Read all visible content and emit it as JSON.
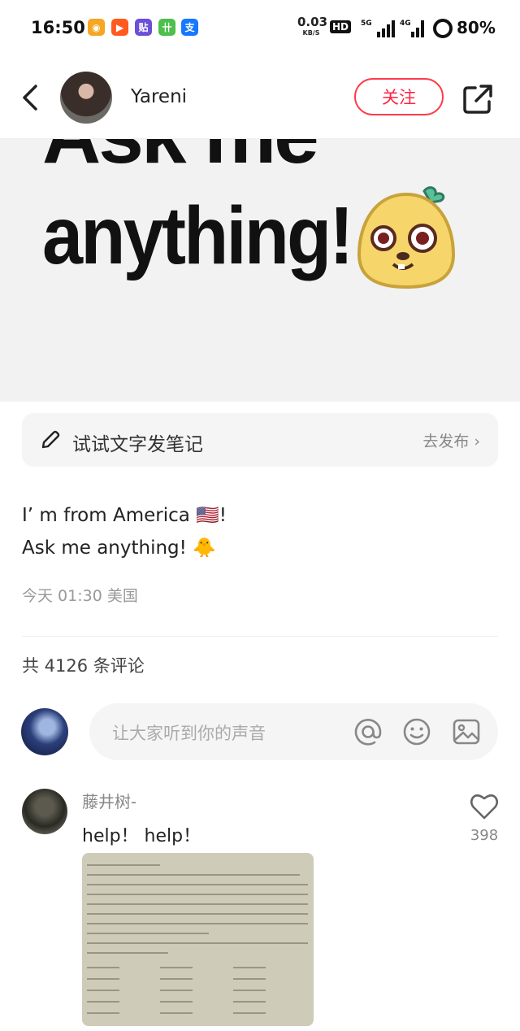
{
  "status_bar": {
    "time": "16:50",
    "net_speed_value": "0.03",
    "net_speed_unit": "KB/S",
    "hd": "HD",
    "battery": "80%",
    "app_icons": [
      "weibo-icon",
      "video-app-icon",
      "tieba-icon",
      "shopping-icon",
      "alipay-icon"
    ]
  },
  "header": {
    "username": "Yareni",
    "follow_label": "关注"
  },
  "hero": {
    "line1": "Ask me",
    "line2": "anything!"
  },
  "write_bar": {
    "label": "试试文字发笔记",
    "action": "去发布 ›"
  },
  "post": {
    "line1": "I’ m from America 🇺🇸!",
    "line2": "Ask me anything! 🐥",
    "meta": "今天 01:30 美国"
  },
  "comments": {
    "count_text": "共 4126 条评论",
    "input_placeholder": "让大家听到你的声音",
    "items": [
      {
        "author": "藤井树-",
        "text": "help！ help！",
        "likes": "398"
      }
    ]
  },
  "colors": {
    "accent": "#ff2442",
    "follow_border": "#ff3b4a"
  }
}
